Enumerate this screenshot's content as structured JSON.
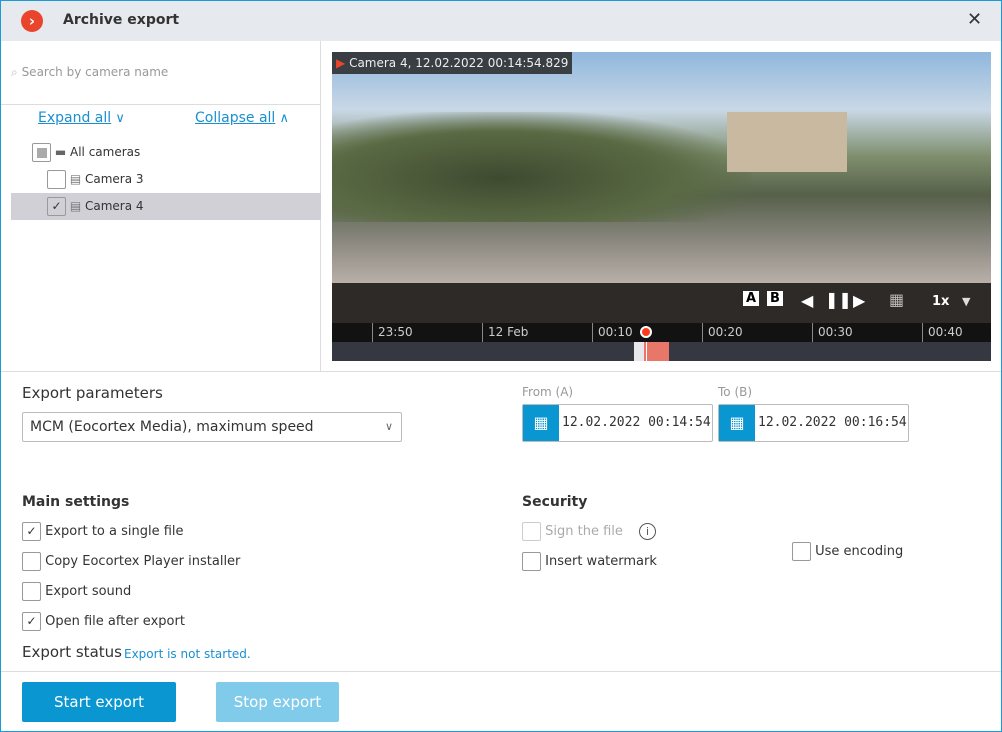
{
  "window": {
    "title": "Archive export"
  },
  "sidebar": {
    "search_placeholder": "Search by camera name",
    "expand_all": "Expand all",
    "collapse_all": "Collapse all",
    "tree": [
      {
        "label": "All cameras",
        "state": "partial"
      },
      {
        "label": "Camera 3",
        "checked": false
      },
      {
        "label": "Camera 4",
        "checked": true,
        "selected": true
      }
    ]
  },
  "player": {
    "caption": "Camera 4, 12.02.2022 00:14:54.829",
    "speed": "1x",
    "ticks": [
      "23:50",
      "12 Feb",
      "00:10",
      "00:20",
      "00:30",
      "00:40"
    ],
    "marker_a": "A",
    "marker_b": "B"
  },
  "params": {
    "label": "Export parameters",
    "format": "MCM (Eocortex Media), maximum speed",
    "from_label": "From (A)",
    "from_value": "12.02.2022  00:14:54",
    "to_label": "To (B)",
    "to_value": "12.02.2022  00:16:54"
  },
  "main_settings": {
    "title": "Main settings",
    "items": [
      {
        "label": "Export to a single file",
        "checked": true
      },
      {
        "label": "Copy Eocortex Player installer",
        "checked": false
      },
      {
        "label": "Export sound",
        "checked": false
      },
      {
        "label": "Open file after export",
        "checked": true
      }
    ]
  },
  "security": {
    "title": "Security",
    "sign": "Sign the file",
    "watermark": "Insert watermark",
    "encoding": "Use encoding"
  },
  "status": {
    "label": "Export status",
    "value": "Export is not started."
  },
  "buttons": {
    "start": "Start export",
    "stop": "Stop export"
  },
  "colors": {
    "accent": "#0a96d0",
    "logo": "#e8452c",
    "playhead": "#ff3b1f"
  }
}
